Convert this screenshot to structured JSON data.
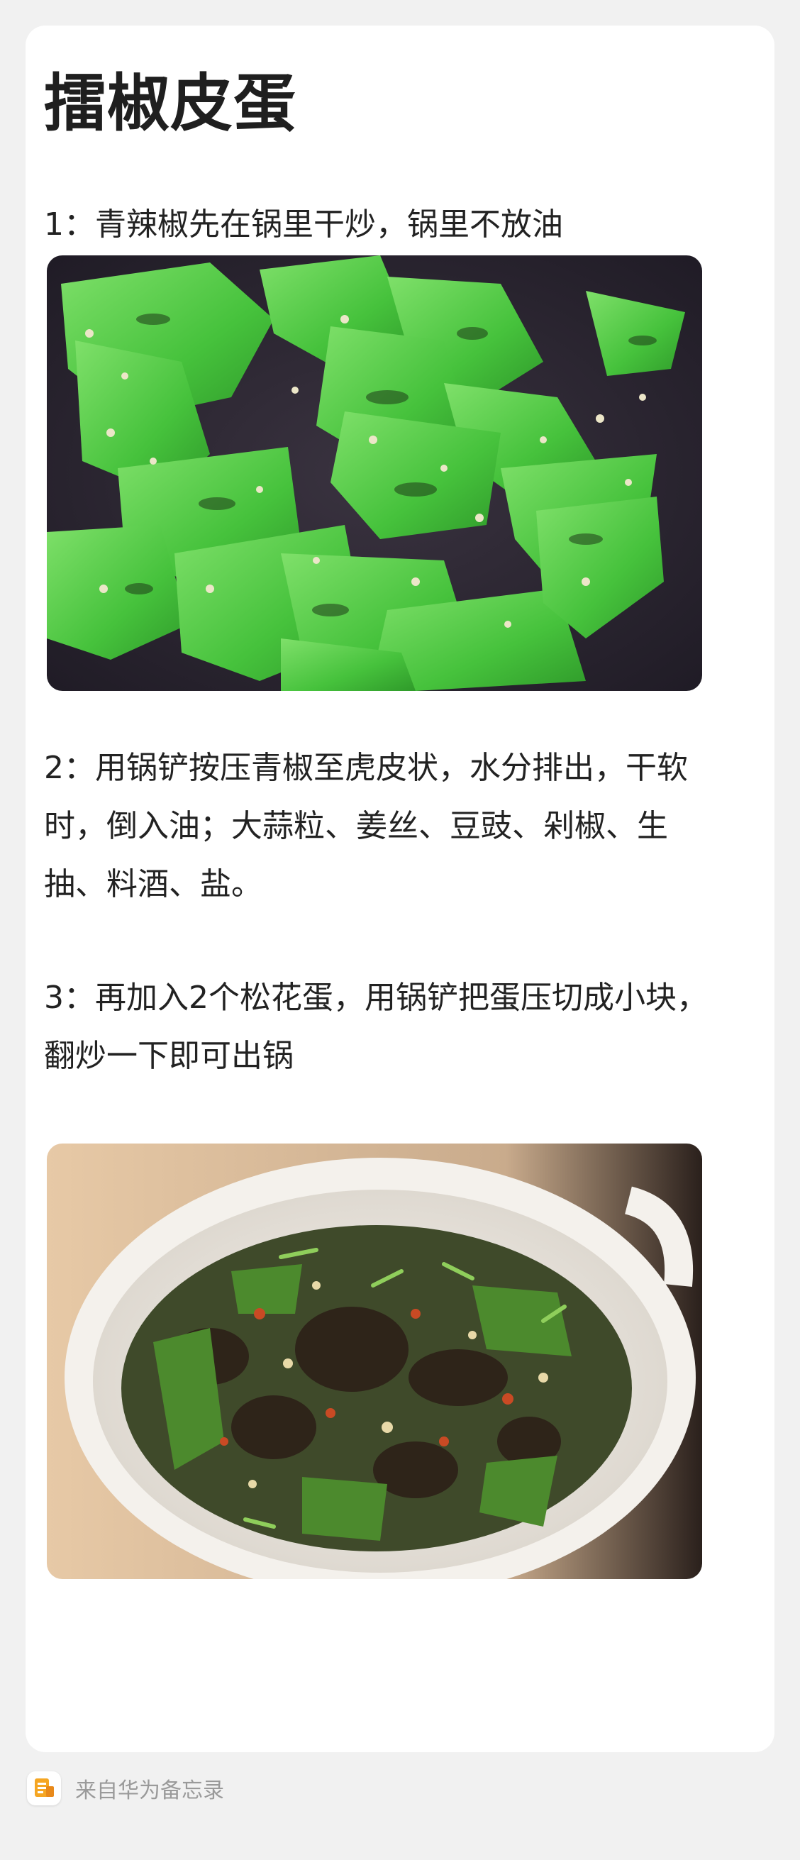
{
  "note": {
    "title": "擂椒皮蛋",
    "step1": "1：青辣椒先在锅里干炒，锅里不放油",
    "step2": "2：用锅铲按压青椒至虎皮状，水分排出，干软时，倒入油；大蒜粒、姜丝、豆豉、剁椒、生抽、料酒、盐。",
    "step3": "3：再加入2个松花蛋，用锅铲把蛋压切成小块，翻炒一下即可出锅"
  },
  "images": {
    "photo1": "charred-green-peppers-in-wok",
    "photo2": "pepper-and-century-egg-dish-in-white-bowl"
  },
  "footer": {
    "source_text": "来自华为备忘录",
    "icon": "huawei-notepad-icon"
  },
  "colors": {
    "background": "#f1f1f1",
    "card": "#ffffff",
    "text": "#222222",
    "footer_text": "#9a9a9a",
    "app_icon_accent": "#f5a623"
  }
}
